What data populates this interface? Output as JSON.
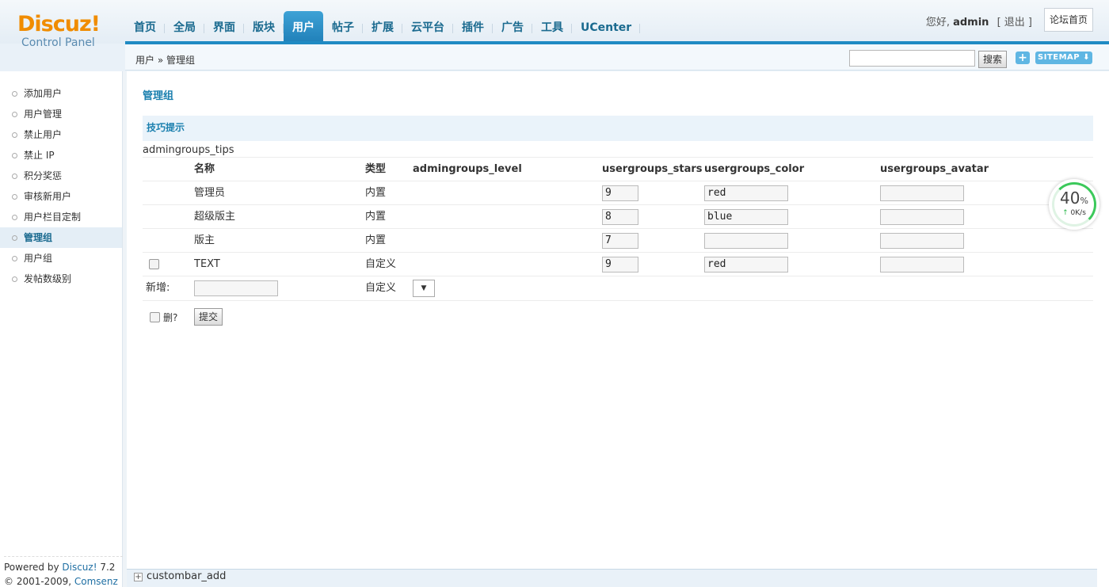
{
  "logo": {
    "brand": "Discuz!",
    "sub": "Control Panel"
  },
  "nav": {
    "tabs": [
      {
        "label": "首页"
      },
      {
        "label": "全局"
      },
      {
        "label": "界面"
      },
      {
        "label": "版块"
      },
      {
        "label": "用户",
        "active": true
      },
      {
        "label": "帖子"
      },
      {
        "label": "扩展"
      },
      {
        "label": "云平台"
      },
      {
        "label": "插件"
      },
      {
        "label": "广告"
      },
      {
        "label": "工具"
      },
      {
        "label": "UCenter"
      }
    ]
  },
  "user": {
    "greeting": "您好,",
    "name": "admin",
    "logout": "[ 退出 ]",
    "home_button": "论坛首页"
  },
  "subbar": {
    "breadcrumb": "用户 » 管理组",
    "search_button": "搜索",
    "plus_button": "+",
    "sitemap_button": "SITEMAP ⬇"
  },
  "sidebar": {
    "items": [
      {
        "label": "添加用户"
      },
      {
        "label": "用户管理"
      },
      {
        "label": "禁止用户"
      },
      {
        "label": "禁止 IP"
      },
      {
        "label": "积分奖惩"
      },
      {
        "label": "审核新用户"
      },
      {
        "label": "用户栏目定制"
      },
      {
        "label": "管理组",
        "active": true
      },
      {
        "label": "用户组"
      },
      {
        "label": "发帖数级别"
      }
    ],
    "powered_prefix": "Powered by ",
    "powered_link": "Discuz!",
    "powered_version": " 7.2",
    "copyright_prefix": "© 2001-2009, ",
    "copyright_link": "Comsenz Inc."
  },
  "main": {
    "title": "管理组",
    "tips_header": "技巧提示",
    "tips_text": "admingroups_tips",
    "columns": {
      "name": "名称",
      "type": "类型",
      "level": "admingroups_level",
      "stars": "usergroups_stars",
      "color": "usergroups_color",
      "avatar": "usergroups_avatar"
    },
    "rows": [
      {
        "name": "管理员",
        "type": "内置",
        "stars": "9",
        "color": "red",
        "avatar": ""
      },
      {
        "name": "超级版主",
        "type": "内置",
        "stars": "8",
        "color": "blue",
        "avatar": ""
      },
      {
        "name": "版主",
        "type": "内置",
        "stars": "7",
        "color": "",
        "avatar": ""
      },
      {
        "name": "TEXT",
        "type": "自定义",
        "stars": "9",
        "color": "red",
        "avatar": "",
        "checkbox": true
      }
    ],
    "new_row": {
      "label": "新增:",
      "type": "自定义",
      "select_arrow": "▼"
    },
    "delete_label": "删?",
    "submit_label": "提交"
  },
  "speed_widget": {
    "percent": "40",
    "percent_sign": "%",
    "rate": "0K/s",
    "arrow": "↑"
  },
  "bottombar": {
    "plus": "+",
    "label": "custombar_add"
  }
}
